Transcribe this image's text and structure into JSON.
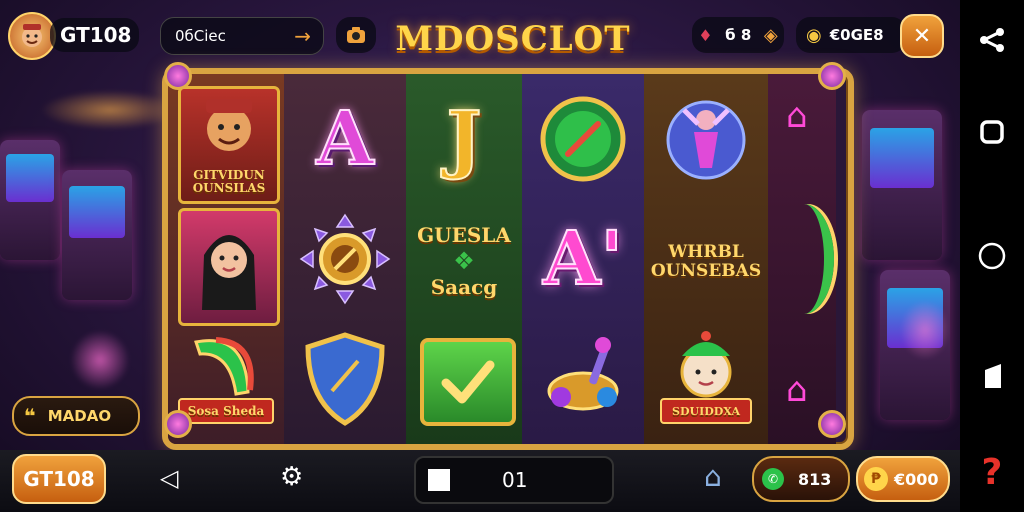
{
  "top": {
    "player_name": "GT108",
    "promo_text": "0бСіес",
    "title": "MDOSCLOT",
    "stat_value": "б 8",
    "coins_value": "€0GE8"
  },
  "symbols": {
    "card1": "GITVIDUN OUNSILAS",
    "card_bottom_left": "Sosa Sheda",
    "letter_a1": "A",
    "letter_j": "J",
    "letter_a2": "A'",
    "wild_top": "GUESLA",
    "wild_bottom": "Saacg",
    "banner_text": "WHRBL OUNSEBAS",
    "elf_badge": "SDUIDDXA"
  },
  "side": {
    "bonus_label": "MADAO"
  },
  "bottom": {
    "brand": "GT108",
    "count": "01",
    "balance": "813",
    "coins": "€000"
  },
  "colors": {
    "gold": "#d9a441",
    "accent_orange": "#f0a23c",
    "magenta": "#e04ad8"
  }
}
